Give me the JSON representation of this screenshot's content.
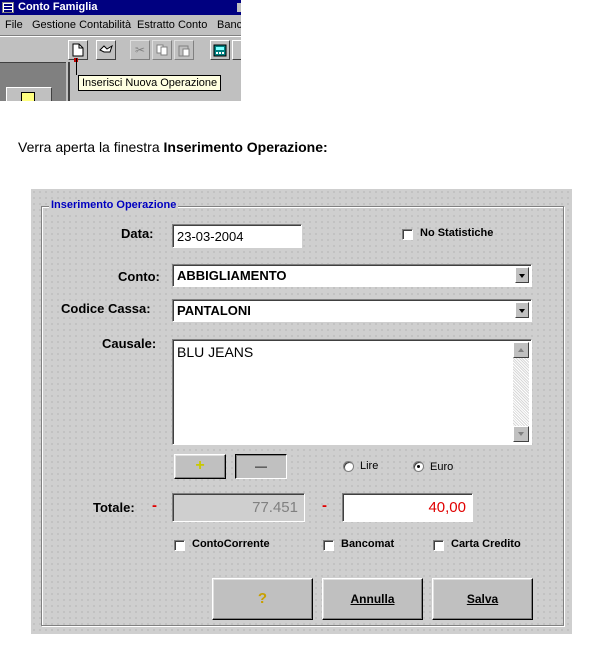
{
  "app_window": {
    "title": "Conto Famiglia",
    "menu": [
      "File",
      "Gestione Contabilità",
      "Estratto Conto",
      "Banc"
    ],
    "toolbar_tooltip": "Inserisci Nuova Operazione"
  },
  "intro": {
    "prefix": "Verra aperta la finestra ",
    "window_name": "Inserimento Operazione",
    "suffix": ":"
  },
  "dialog": {
    "group_title": "Inserimento Operazione",
    "data": {
      "label": "Data:",
      "value": "23-03-2004"
    },
    "no_statistiche": {
      "label": "No Statistiche",
      "checked": false
    },
    "conto": {
      "label": "Conto:",
      "value": "ABBIGLIAMENTO"
    },
    "codice_cassa": {
      "label": "Codice Cassa:",
      "value": "PANTALONI"
    },
    "causale": {
      "label": "Causale:",
      "value": "BLU JEANS"
    },
    "plus_button": "+",
    "minus_button": "—",
    "currency": {
      "lire": {
        "label": "Lire",
        "selected": false
      },
      "euro": {
        "label": "Euro",
        "selected": true
      }
    },
    "totale": {
      "label": "Totale:",
      "sign_left": "-",
      "value_left": "77.451",
      "sign_right": "-",
      "value_right": "40,00"
    },
    "checkboxes": {
      "conto_corrente": {
        "label": "ContoCorrente",
        "checked": false
      },
      "bancomat": {
        "label": "Bancomat",
        "checked": false
      },
      "carta_credito": {
        "label": "Carta Credito",
        "checked": false
      }
    },
    "buttons": {
      "help": "?",
      "annulla": "Annulla",
      "salva": "Salva"
    }
  },
  "colors": {
    "title_bar": "#000080",
    "group_title": "#0000c0",
    "negative_red": "#e00000",
    "dialog_face": "#cfcfcf"
  }
}
